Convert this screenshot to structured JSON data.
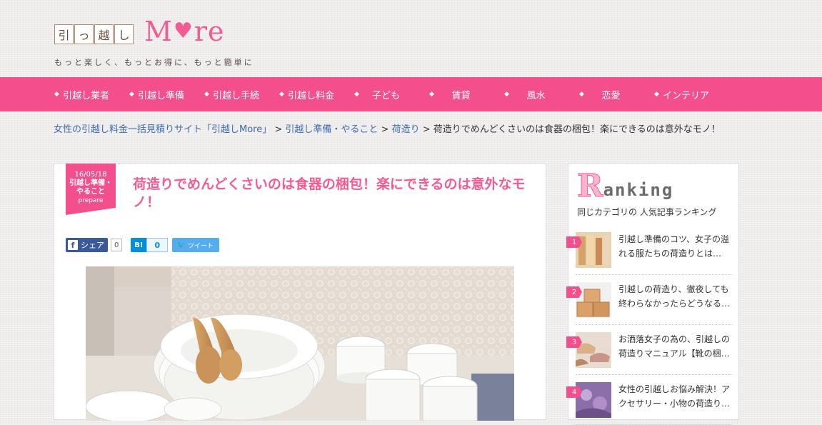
{
  "header": {
    "logo_chars": [
      "引",
      "っ",
      "越",
      "し"
    ],
    "logo_more_m": "M",
    "logo_more_rest": "re",
    "tagline": "もっと楽しく、もっとお得に、もっと簡単に"
  },
  "nav": {
    "items": [
      {
        "label": "引越し業者"
      },
      {
        "label": "引越し準備"
      },
      {
        "label": "引越し手続"
      },
      {
        "label": "引越し料金"
      },
      {
        "label": "子ども"
      },
      {
        "label": "賃貸"
      },
      {
        "label": "風水"
      },
      {
        "label": "恋愛"
      },
      {
        "label": "インテリア"
      }
    ]
  },
  "breadcrumb": {
    "home": "女性の引越し料金一括見積りサイト「引越しMore」",
    "sep": " > ",
    "cat1": "引越し準備・やること",
    "cat2": "荷造り",
    "current": "荷造りでめんどくさいのは食器の梱包！楽にできるのは意外なモノ！"
  },
  "article": {
    "date": "16/05/18",
    "category_line1": "引越し準備・",
    "category_line2": "やること",
    "category_en": "prepare",
    "title": "荷造りでめんどくさいのは食器の梱包！楽にできるのは意外なモノ！",
    "share": {
      "fb_label": "シェア",
      "fb_count": "0",
      "hb_label": "B!",
      "hb_count": "0",
      "tw_label": "ツイート"
    }
  },
  "sidebar": {
    "ranking_R": "R",
    "ranking_rest": "anking",
    "subtitle": "同じカテゴリの 人気記事ランキング",
    "items": [
      {
        "num": "1",
        "text": "引越し準備のコツ、女子の溢れる服たちの荷造りとは…"
      },
      {
        "num": "2",
        "text": "引越しの荷造り、徹夜しても終わらなかったらどうなる…"
      },
      {
        "num": "3",
        "text": "お洒落女子の為の、引越しの荷造りマニュアル【靴の梱…"
      },
      {
        "num": "4",
        "text": "女性の引越しお悩み解決！アクセサリー・小物の荷造り…"
      }
    ]
  },
  "colors": {
    "brand_pink": "#f24f8c",
    "link_blue": "#3a6ab0"
  }
}
